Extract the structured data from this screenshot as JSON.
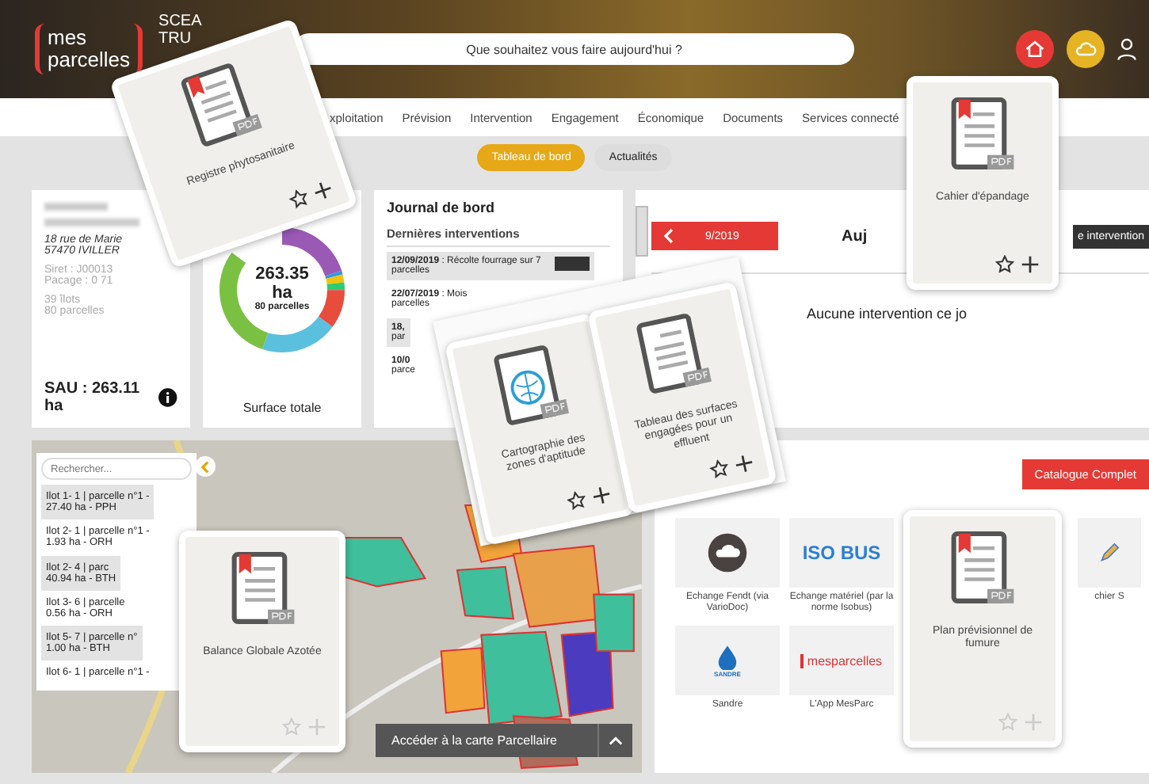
{
  "header": {
    "logo": [
      "mes",
      "parcelles"
    ],
    "account": [
      "SCEA",
      "TRU"
    ],
    "search": {
      "placeholder": "Que souhaitez vous faire aujourd'hui ?"
    }
  },
  "nav": [
    "xploitation",
    "Prévision",
    "Intervention",
    "Engagement",
    "Économique",
    "Documents",
    "Services connecté"
  ],
  "tabs": [
    {
      "label": "Tableau de bord",
      "selected": true
    },
    {
      "label": "Actualités",
      "selected": false
    }
  ],
  "farm": {
    "address": [
      "18 rue de Marie",
      "57470 IVILLER"
    ],
    "ids": [
      "Siret : J00013",
      "Pacage : 0 71"
    ],
    "counts": [
      "39 îlots",
      "80 parcelles"
    ],
    "sau": "SAU : 263.11 ha"
  },
  "surface": {
    "total": "263.35",
    "unit": "ha",
    "count": "80 parcelles",
    "label": "Surface totale"
  },
  "journal": {
    "title": "Journal de bord",
    "subtitle": "Dernières interventions",
    "entries": [
      {
        "text": "**12/09/2019** : Récolte fourrage sur 7 parcelles",
        "shaded": true
      },
      {
        "text": "**22/07/2019** : Mois parcelles",
        "shaded": false
      },
      {
        "text": "**18,**\npar",
        "shaded": true
      },
      {
        "text": "**10/0**\nparce",
        "shaded": false
      }
    ]
  },
  "day": {
    "date": "9/2019",
    "heading": "Auj",
    "empty": "Aucune intervention ce jo",
    "add_button": "e intervention"
  },
  "map": {
    "search": {
      "placeholder": "Rechercher..."
    },
    "parcels": [
      [
        "Ilot 1- 1 | parcelle n°1 -",
        "27.40 ha - PPH"
      ],
      [
        "Ilot 2- 1 | parcelle n°1 -",
        "1.93 ha - ORH"
      ],
      [
        "Ilot 2- 4 | parc",
        "40.94 ha - BTH"
      ],
      [
        "Ilot 3- 6 | parcelle",
        "0.56 ha - ORH"
      ],
      [
        "Ilot 5- 7 | parcelle n°",
        "1.00 ha - BTH"
      ],
      [
        "Ilot 6- 1 | parcelle n°1 -"
      ]
    ],
    "button": "Accéder à la carte Parcellaire"
  },
  "catalogue": {
    "button": "Catalogue Complet",
    "services": [
      {
        "kind": "cloud",
        "label": "Echange Fendt (via VarioDoc)"
      },
      {
        "kind": "isobus",
        "logo_text": [
          "ISO",
          "BUS"
        ],
        "label": "Echange matériel (par la norme Isobus)"
      },
      {
        "kind": "pen",
        "label": "chier S"
      },
      {
        "kind": "sandre",
        "logo_text": [
          "SANDRE"
        ],
        "label": "Sandre"
      },
      {
        "kind": "mesparcelles",
        "logo_text": [
          "mesparcelles"
        ],
        "label": "L'App MesParc"
      }
    ]
  },
  "documents": [
    {
      "title": "Registre phytosanitaire",
      "kind": "bookmark",
      "faded": false
    },
    {
      "title": "Cahier d'épandage",
      "kind": "bookmark",
      "faded": false
    },
    {
      "title": "Cartographie des zones d'aptitude",
      "kind": "globe",
      "faded": false
    },
    {
      "title": "Tableau des surfaces engagées pour un effluent",
      "kind": "lines",
      "faded": false
    },
    {
      "title": "Balance Globale Azotée",
      "kind": "bookmark",
      "faded": true
    },
    {
      "title": "Plan prévisionnel de fumure",
      "kind": "bookmark",
      "faded": true
    }
  ]
}
